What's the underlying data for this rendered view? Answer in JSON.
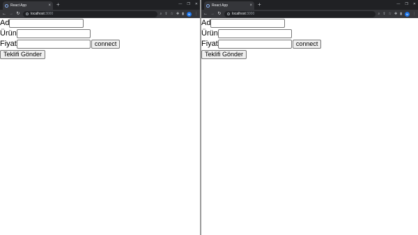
{
  "browser": {
    "tab_title": "React App",
    "tab_close": "×",
    "new_tab": "+",
    "url_host": "localhost",
    "url_port": ":3000",
    "profile_initial": "M",
    "window_controls": [
      "—",
      "❐",
      "✕"
    ],
    "accent": "#1a73e8"
  },
  "form": {
    "name_label": "Ad",
    "product_label": "Ürün",
    "price_label": "Fiyat",
    "name_value": "",
    "product_value": "",
    "price_value": "",
    "connect_label": "connect",
    "submit_label": "Teklifi Gönder"
  }
}
